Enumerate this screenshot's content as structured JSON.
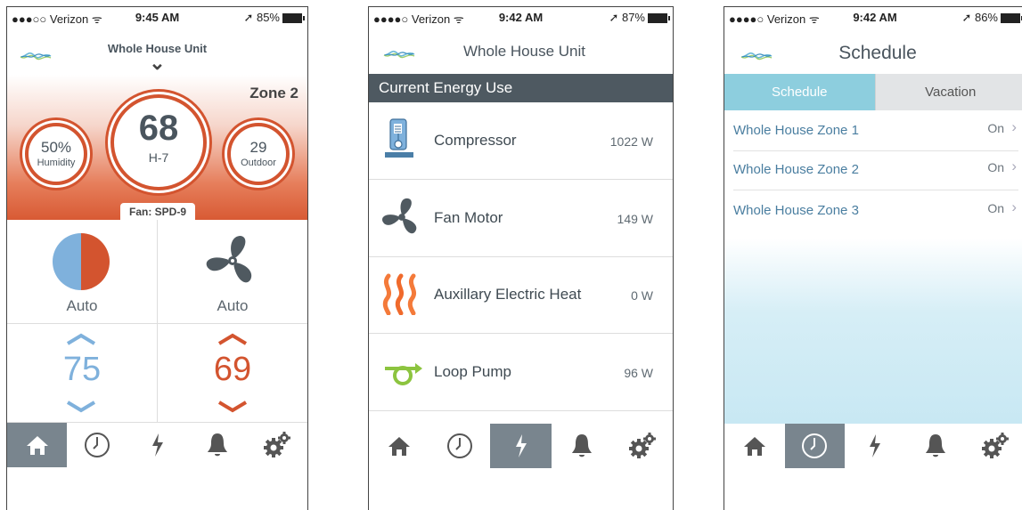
{
  "screens": [
    {
      "status": {
        "carrier": "●●●○○ Verizon ᯤ",
        "time": "9:45 AM",
        "battery": "➚ 85%"
      },
      "header": {
        "title": "Whole House Unit",
        "chevron": "⌄"
      },
      "zone": "Zone 2",
      "humidity": {
        "value": "50%",
        "label": "Humidity"
      },
      "temp": {
        "value": "68",
        "label": "H-7"
      },
      "outdoor": {
        "value": "29",
        "label": "Outdoor"
      },
      "fan_badge": "Fan: SPD-9",
      "mode_label": "Auto",
      "fan_label": "Auto",
      "cool_setpoint": "75",
      "heat_setpoint": "69",
      "colors": {
        "accent": "#d3542f",
        "cool": "#7fb1dc"
      }
    },
    {
      "status": {
        "carrier": "●●●●○ Verizon ᯤ",
        "time": "9:42 AM",
        "battery": "➚ 87%"
      },
      "header": {
        "title": "Whole House Unit"
      },
      "section_title": "Current Energy Use",
      "items": [
        {
          "label": "Compressor",
          "value": "1022 W",
          "icon": "compressor-icon"
        },
        {
          "label": "Fan Motor",
          "value": "149 W",
          "icon": "fan-icon"
        },
        {
          "label": "Auxillary Electric Heat",
          "value": "0 W",
          "icon": "heat-icon"
        },
        {
          "label": "Loop Pump",
          "value": "96 W",
          "icon": "pump-icon"
        }
      ]
    },
    {
      "status": {
        "carrier": "●●●●○ Verizon ᯤ",
        "time": "9:42 AM",
        "battery": "➚ 86%"
      },
      "header": {
        "title": "Schedule"
      },
      "tabs": [
        "Schedule",
        "Vacation"
      ],
      "zones": [
        {
          "label": "Whole House Zone 1",
          "value": "On"
        },
        {
          "label": "Whole House Zone 2",
          "value": "On"
        },
        {
          "label": "Whole House Zone 3",
          "value": "On"
        }
      ]
    }
  ]
}
